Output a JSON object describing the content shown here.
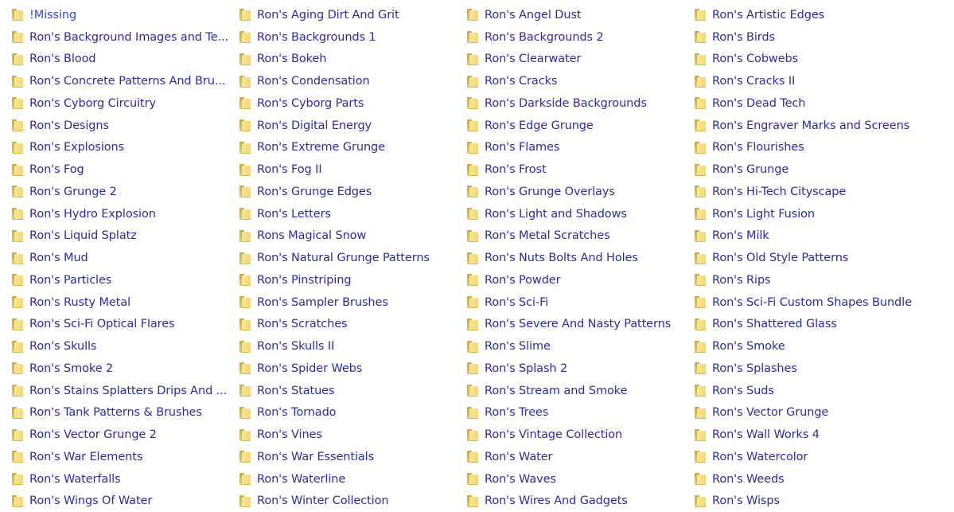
{
  "folder_icon": "folder-icon",
  "colors": {
    "text": "#2c2c9c",
    "background": "#ffffff",
    "folder": "#f3d77a"
  },
  "columns": [
    [
      "!Missing",
      "Ron's Background Images and Te...",
      "Ron's Blood",
      "Ron's Concrete Patterns And Bru...",
      "Ron's Cyborg Circuitry",
      "Ron's Designs",
      "Ron's Explosions",
      "Ron's Fog",
      "Ron's Grunge 2",
      "Ron's Hydro Explosion",
      "Ron's Liquid Splatz",
      "Ron's Mud",
      "Ron's Particles",
      "Ron's Rusty Metal",
      "Ron's Sci-Fi Optical Flares",
      "Ron's Skulls",
      "Ron's Smoke 2",
      "Ron's Stains Splatters Drips And ...",
      "Ron's Tank Patterns & Brushes",
      "Ron's Vector Grunge 2",
      "Ron's War Elements",
      "Ron's Waterfalls",
      "Ron's Wings Of Water"
    ],
    [
      "Ron's Aging Dirt And Grit",
      "Ron's Backgrounds 1",
      "Ron's Bokeh",
      "Ron's Condensation",
      "Ron's Cyborg Parts",
      "Ron's Digital Energy",
      "Ron's Extreme Grunge",
      "Ron's Fog II",
      "Ron's Grunge Edges",
      "Ron's Letters",
      "Rons Magical Snow",
      "Ron's Natural Grunge Patterns",
      "Ron's Pinstriping",
      "Ron's Sampler Brushes",
      "Ron's Scratches",
      "Ron's Skulls II",
      "Ron's Spider Webs",
      "Ron's Statues",
      "Ron's Tornado",
      "Ron's Vines",
      "Ron's War Essentials",
      "Ron's Waterline",
      "Ron's Winter Collection"
    ],
    [
      "Ron's Angel Dust",
      "Ron's Backgrounds 2",
      "Ron's Clearwater",
      "Ron's Cracks",
      "Ron's Darkside Backgrounds",
      "Ron's Edge Grunge",
      "Ron's Flames",
      "Ron's Frost",
      "Ron's Grunge Overlays",
      "Ron's Light and Shadows",
      "Ron's Metal Scratches",
      "Ron's Nuts Bolts And Holes",
      "Ron's Powder",
      "Ron's Sci-Fi",
      "Ron's Severe And Nasty Patterns",
      "Ron's Slime",
      "Ron's Splash 2",
      "Ron's Stream and Smoke",
      "Ron's Trees",
      "Ron's Vintage Collection",
      "Ron's Water",
      "Ron's Waves",
      "Ron's Wires And Gadgets"
    ],
    [
      "Ron's Artistic Edges",
      "Ron's Birds",
      "Ron's Cobwebs",
      "Ron's Cracks II",
      "Ron's Dead Tech",
      "Ron's Engraver Marks and Screens",
      "Ron's Flourishes",
      "Ron's Grunge",
      "Ron's Hi-Tech Cityscape",
      "Ron's Light Fusion",
      "Ron's Milk",
      "Ron's Old Style Patterns",
      "Ron's Rips",
      "Ron's Sci-Fi Custom Shapes Bundle",
      "Ron's Shattered Glass",
      "Ron's Smoke",
      "Ron's Splashes",
      "Ron's Suds",
      "Ron's Vector Grunge",
      "Ron's Wall Works 4",
      "Ron's Watercolor",
      "Ron's Weeds",
      "Ron's Wisps"
    ]
  ]
}
